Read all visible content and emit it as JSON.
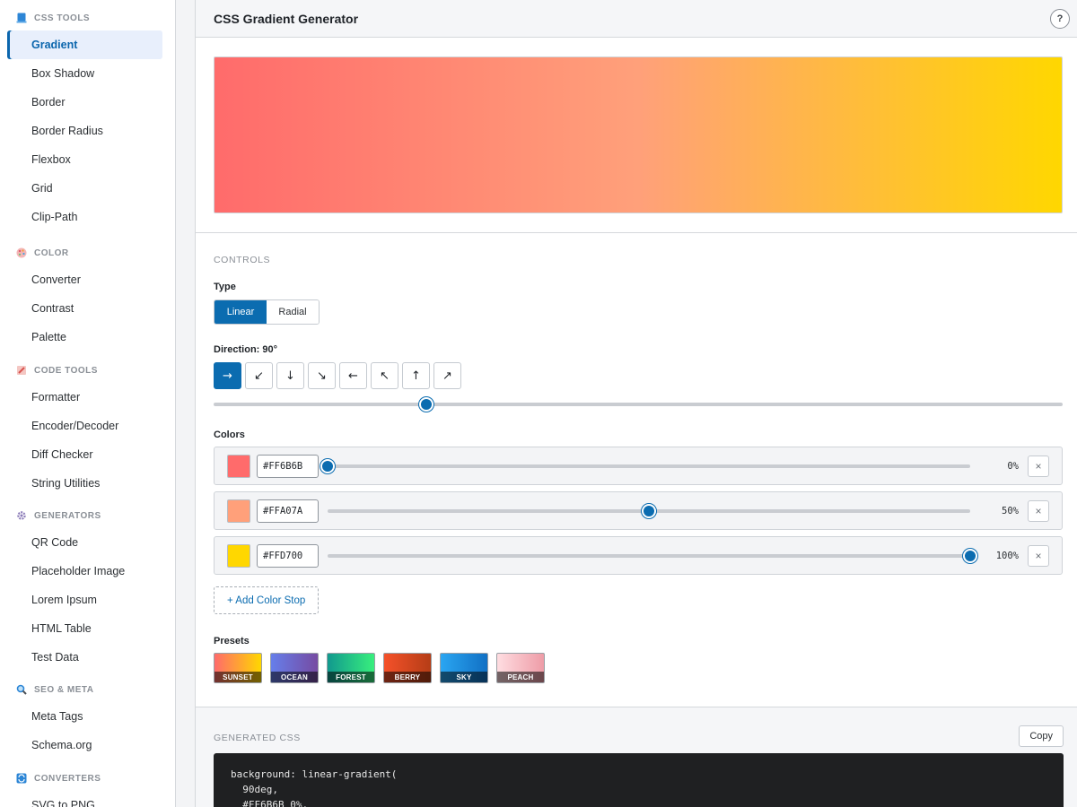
{
  "sidebar": {
    "sections": [
      {
        "title": "CSS TOOLS",
        "icon": "css-tools-icon",
        "icon_color": "#2d86d6",
        "items": [
          "Gradient",
          "Box Shadow",
          "Border",
          "Border Radius",
          "Flexbox",
          "Grid",
          "Clip-Path"
        ]
      },
      {
        "title": "COLOR",
        "icon": "palette-icon",
        "icon_color": "#e05a6e",
        "items": [
          "Converter",
          "Contrast",
          "Palette"
        ]
      },
      {
        "title": "CODE TOOLS",
        "icon": "code-tools-icon",
        "icon_color": "#d9534f",
        "items": [
          "Formatter",
          "Encoder/Decoder",
          "Diff Checker",
          "String Utilities"
        ]
      },
      {
        "title": "GENERATORS",
        "icon": "gear-icon",
        "icon_color": "#8b7bb8",
        "items": [
          "QR Code",
          "Placeholder Image",
          "Lorem Ipsum",
          "HTML Table",
          "Test Data"
        ]
      },
      {
        "title": "SEO & META",
        "icon": "search-icon",
        "icon_color": "#2d86d6",
        "items": [
          "Meta Tags",
          "Schema.org"
        ]
      },
      {
        "title": "CONVERTERS",
        "icon": "converters-icon",
        "icon_color": "#2d86d6",
        "items": [
          "SVG to PNG"
        ]
      }
    ],
    "active_item": "Gradient"
  },
  "header": {
    "title": "CSS Gradient Generator",
    "help_label": "?"
  },
  "preview": {
    "colors": [
      "#FF6B6B",
      "#FFA07A",
      "#FFD700"
    ]
  },
  "controls": {
    "heading": "CONTROLS",
    "type_label": "Type",
    "type_options": [
      "Linear",
      "Radial"
    ],
    "type_selected": "Linear",
    "direction_label": "Direction: 90°",
    "direction_buttons": [
      "→",
      "↙",
      "↓",
      "↘",
      "←",
      "↖",
      "↑",
      "↗"
    ],
    "direction_icons": [
      "arrow-right-icon",
      "arrow-down-left-icon",
      "arrow-down-icon",
      "arrow-down-right-icon",
      "arrow-left-icon",
      "arrow-up-left-icon",
      "arrow-up-icon",
      "arrow-up-right-icon"
    ],
    "direction_selected_index": 0,
    "direction_angle": 90,
    "direction_max": 360,
    "colors_label": "Colors",
    "stops": [
      {
        "hex": "#FF6B6B",
        "position": 0,
        "position_label": "0%",
        "remove": "×"
      },
      {
        "hex": "#FFA07A",
        "position": 50,
        "position_label": "50%",
        "remove": "×"
      },
      {
        "hex": "#FFD700",
        "position": 100,
        "position_label": "100%",
        "remove": "×"
      }
    ],
    "add_stop_label": "+ Add Color Stop",
    "presets_label": "Presets",
    "presets": [
      {
        "name": "SUNSET",
        "from": "#ff6b6b",
        "to": "#ffd700"
      },
      {
        "name": "OCEAN",
        "from": "#667eea",
        "to": "#764ba2"
      },
      {
        "name": "FOREST",
        "from": "#11998e",
        "to": "#38ef7d"
      },
      {
        "name": "BERRY",
        "from": "#f5512a",
        "to": "#b53d16"
      },
      {
        "name": "SKY",
        "from": "#2aa6f2",
        "to": "#1170c4"
      },
      {
        "name": "PEACH",
        "from": "#ffdde1",
        "to": "#ee9ca7"
      }
    ]
  },
  "generated": {
    "heading": "GENERATED CSS",
    "copy_label": "Copy",
    "code": "background: linear-gradient(\n  90deg,\n  #FF6B6B 0%,"
  },
  "colors": {
    "accent": "#0b6cb0"
  }
}
